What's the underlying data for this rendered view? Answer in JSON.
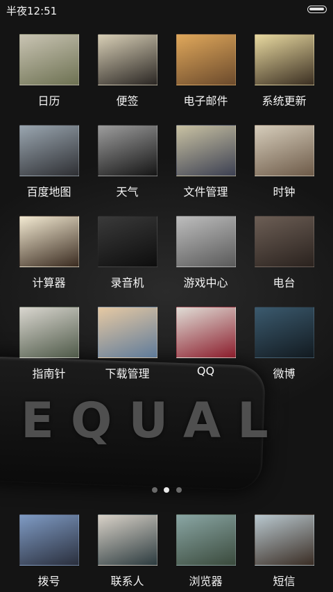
{
  "status_bar": {
    "time": "半夜12:51",
    "battery_icon": "battery-full-icon"
  },
  "apps": [
    {
      "label": "日历",
      "thumb": [
        "#c9c4b3",
        "#6d7152"
      ]
    },
    {
      "label": "便签",
      "thumb": [
        "#d8cfb6",
        "#2a2623"
      ]
    },
    {
      "label": "电子邮件",
      "thumb": [
        "#e0a85b",
        "#6b4a2c"
      ]
    },
    {
      "label": "系统更新",
      "thumb": [
        "#e8d9a0",
        "#3b2f22"
      ]
    },
    {
      "label": "百度地图",
      "thumb": [
        "#9aa6b0",
        "#2e2f33"
      ]
    },
    {
      "label": "天气",
      "thumb": [
        "#9d9d9d",
        "#151515"
      ]
    },
    {
      "label": "文件管理",
      "thumb": [
        "#c9c2a3",
        "#3c4052"
      ]
    },
    {
      "label": "时钟",
      "thumb": [
        "#d6cdbb",
        "#6d5a48"
      ]
    },
    {
      "label": "计算器",
      "thumb": [
        "#f3ead2",
        "#3a2b20"
      ]
    },
    {
      "label": "录音机",
      "thumb": [
        "#3a3a3a",
        "#0d0d0d"
      ]
    },
    {
      "label": "游戏中心",
      "thumb": [
        "#bdbdbd",
        "#5a5a5a"
      ]
    },
    {
      "label": "电台",
      "thumb": [
        "#6c5e55",
        "#2a221e"
      ]
    },
    {
      "label": "指南针",
      "thumb": [
        "#d9d6cf",
        "#4f5a49"
      ]
    },
    {
      "label": "下载管理",
      "thumb": [
        "#e6c9a3",
        "#5f7b9a"
      ]
    },
    {
      "label": "QQ",
      "thumb": [
        "#e0ddd6",
        "#8b1d2c"
      ]
    },
    {
      "label": "微博",
      "thumb": [
        "#3b5a6e",
        "#121a20"
      ]
    }
  ],
  "page_indicator": {
    "count": 3,
    "active_index": 1
  },
  "dock": [
    {
      "label": "拨号",
      "thumb": [
        "#7f9bc4",
        "#2a2f3d"
      ]
    },
    {
      "label": "联系人",
      "thumb": [
        "#d9d2c8",
        "#2c3b3f"
      ]
    },
    {
      "label": "浏览器",
      "thumb": [
        "#8aa6a4",
        "#3a4a3c"
      ]
    },
    {
      "label": "短信",
      "thumb": [
        "#b9c8cf",
        "#3a2d24"
      ]
    }
  ],
  "wallpaper_text": "EQUAL"
}
